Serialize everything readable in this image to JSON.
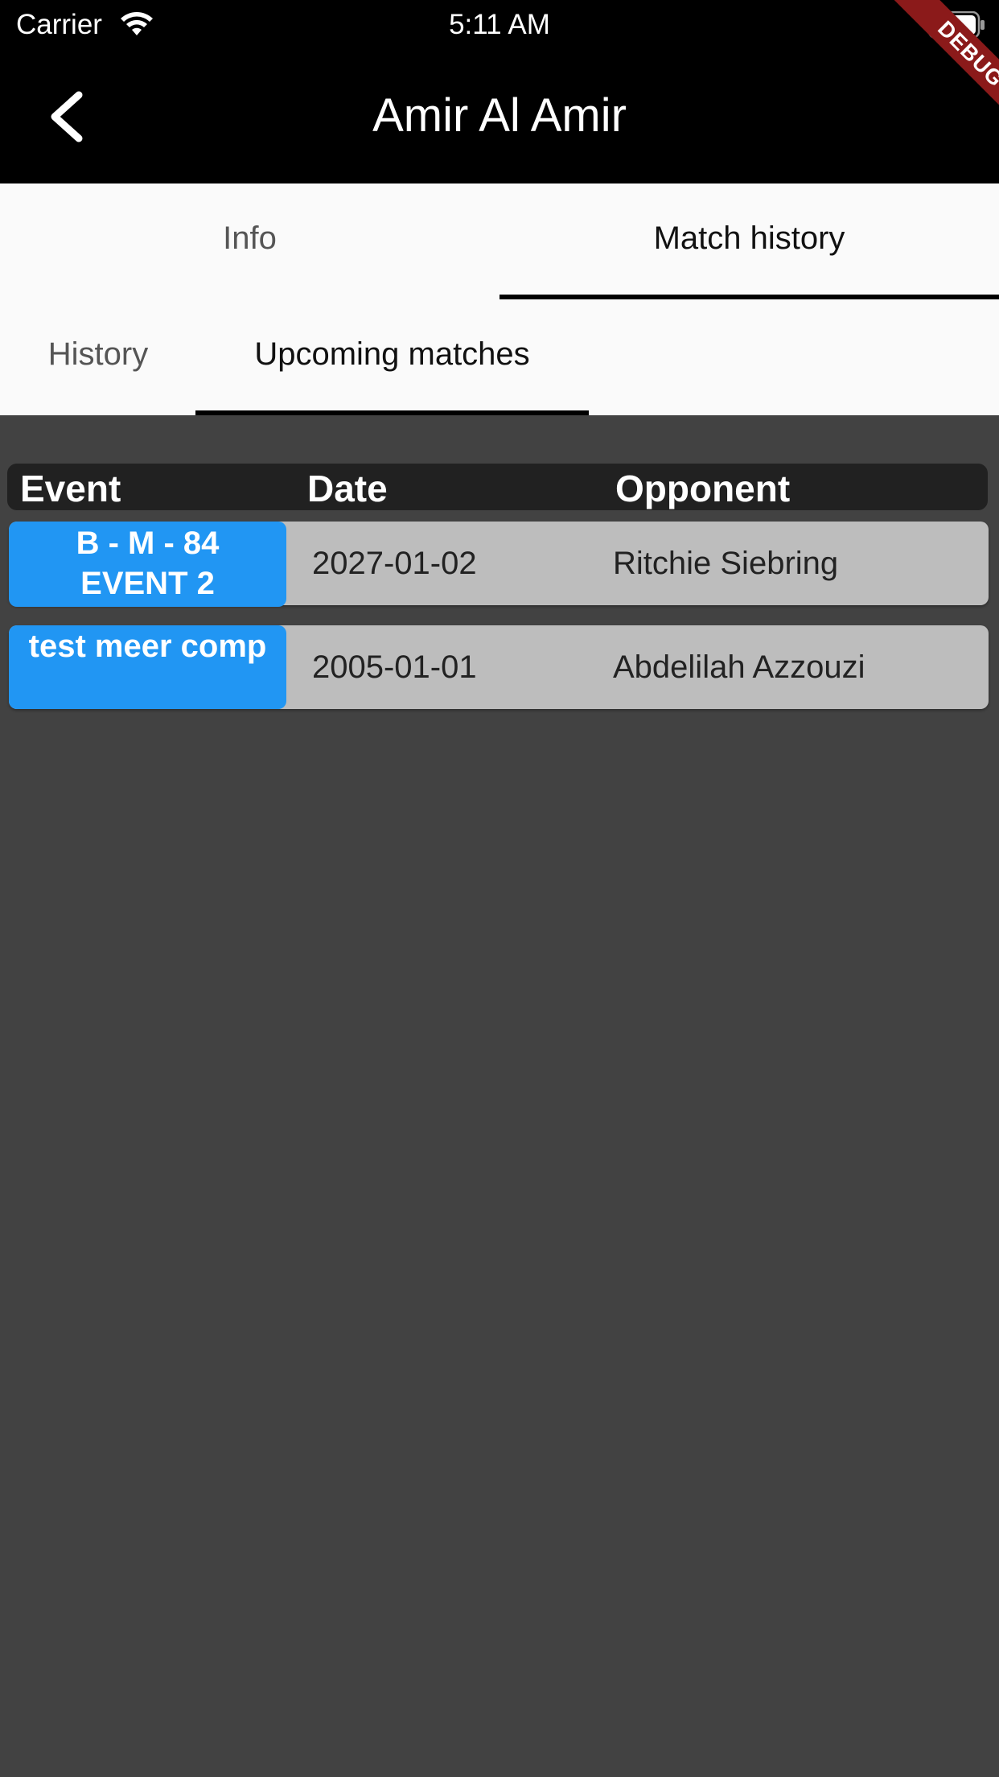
{
  "status_bar": {
    "carrier": "Carrier",
    "time": "5:11 AM"
  },
  "app_bar": {
    "title": "Amir Al Amir",
    "debug_label": "DEBUG"
  },
  "tabs": [
    {
      "label": "Info",
      "active": false
    },
    {
      "label": "Match history",
      "active": true
    }
  ],
  "sub_tabs": [
    {
      "label": "History",
      "active": false
    },
    {
      "label": "Upcoming matches",
      "active": true
    }
  ],
  "table": {
    "headers": {
      "event": "Event",
      "date": "Date",
      "opponent": "Opponent"
    },
    "rows": [
      {
        "event_line1": "B - M - 84",
        "event_line2": "EVENT 2",
        "date": "2027-01-02",
        "opponent": "Ritchie Siebring"
      },
      {
        "event_line1": "test meer comp",
        "event_line2": "",
        "date": "2005-01-01",
        "opponent": "Abdelilah Azzouzi"
      }
    ]
  },
  "colors": {
    "event_badge": "#2196f3",
    "row_bg": "#bdbdbd",
    "page_bg": "#424242",
    "header_bg": "#212121"
  }
}
